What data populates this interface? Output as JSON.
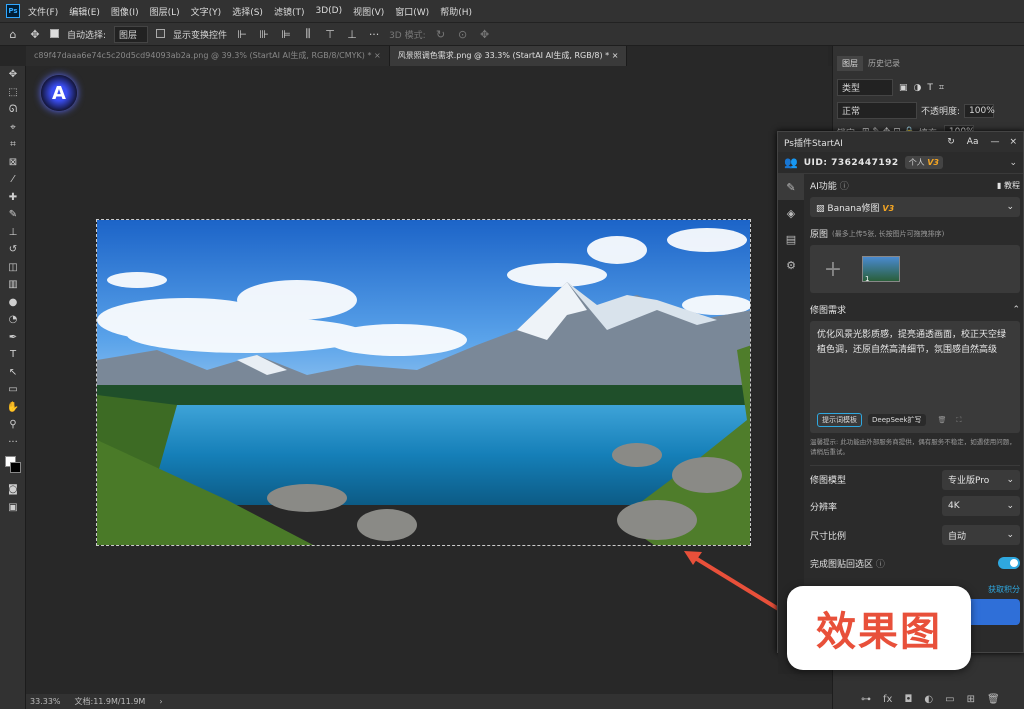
{
  "menu": {
    "logo": "Ps",
    "items": [
      "文件(F)",
      "编辑(E)",
      "图像(I)",
      "图层(L)",
      "文字(Y)",
      "选择(S)",
      "滤镜(T)",
      "3D(D)",
      "视图(V)",
      "窗口(W)",
      "帮助(H)"
    ]
  },
  "options": {
    "auto_select_label": "自动选择:",
    "layer_select": "图层",
    "show_transform": "显示变换控件",
    "mode_3d": "3D 模式:"
  },
  "tabs": [
    {
      "label": "c89f47daaa6e74c5c20d5cd94093ab2a.png @ 39.3% (StartAI AI生成, RGB/8/CMYK) *",
      "active": false
    },
    {
      "label": "风景照调色需求.png @ 33.3% (StartAI AI生成, RGB/8) *",
      "active": true
    }
  ],
  "status": {
    "zoom": "33.33%",
    "doc": "文档:11.9M/11.9M"
  },
  "right_panel": {
    "tab_layers": "图层",
    "tab_history": "历史记录",
    "kind": "类型",
    "blend": "正常",
    "opacity_label": "不透明度:",
    "opacity": "100%",
    "lock_label": "锁定:",
    "fill_label": "填充:",
    "fill": "100%"
  },
  "plugin": {
    "title": "Ps插件StartAI",
    "uid": "UID: 7362447192",
    "account": "个人",
    "account_badge": "V3",
    "ai_function_label": "AI功能",
    "tutorial": "教程",
    "function_name": "Banana修图",
    "function_badge": "V3",
    "original_label": "原图",
    "original_hint": "(最多上传5张, 长按图片可拖拽排序)",
    "thumb_count": "1",
    "requirement_label": "修图需求",
    "requirement_text": "优化风景光影质感，提亮通透画面，校正天空绿植色调，还原自然高清细节，氛围感自然高级",
    "prompt_template": "提示词模板",
    "deepseek": "DeepSeek扩写",
    "notice": "温馨提示: 此功能由外部服务商提供，偶有服务不稳定，如遇使用问题，请稍后重试。",
    "model_label": "修图模型",
    "model_value": "专业版Pro",
    "resolution_label": "分辨率",
    "resolution_value": "4K",
    "ratio_label": "尺寸比例",
    "ratio_value": "自动",
    "paste_back_label": "完成图贴回选区",
    "get_points": "获取积分"
  },
  "callout": "效果图",
  "colors": {
    "accent": "#2fa8e0",
    "callout_text": "#e8503a",
    "arrow": "#e8503a"
  }
}
